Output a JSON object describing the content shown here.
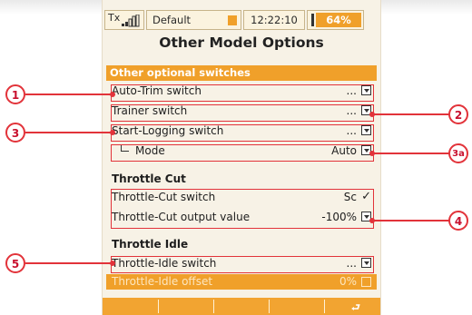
{
  "status_bar": {
    "tx_label": "Tx",
    "model_name": "Default",
    "time": "12:22:10",
    "battery": "64%"
  },
  "page": {
    "title": "Other Model Options",
    "section_other": "Other optional switches"
  },
  "rows": {
    "auto_trim": {
      "label": "Auto-Trim switch",
      "value": "..."
    },
    "trainer": {
      "label": "Trainer switch",
      "value": "..."
    },
    "start_logging": {
      "label": "Start-Logging switch",
      "value": "..."
    },
    "mode": {
      "label": "Mode",
      "value": "Auto"
    },
    "throttle_cut_heading": "Throttle Cut",
    "throttle_cut_switch": {
      "label": "Throttle-Cut switch",
      "value": "Sc"
    },
    "throttle_cut_output": {
      "label": "Throttle-Cut output value",
      "value": "-100%"
    },
    "throttle_idle_heading": "Throttle Idle",
    "throttle_idle_switch": {
      "label": "Throttle-Idle switch",
      "value": "..."
    },
    "throttle_idle_offset": {
      "label": "Throttle-Idle offset",
      "value": "0%"
    }
  },
  "callouts": [
    "1",
    "2",
    "3",
    "3a",
    "4",
    "5"
  ],
  "colors": {
    "accent": "#f0a02a",
    "callout": "#e2333a"
  },
  "icons": [
    "antenna-signal-icon",
    "model-icon",
    "battery-icon",
    "dropdown-arrow-icon",
    "checkmark-icon",
    "sub-item-arrow-icon",
    "return-icon"
  ]
}
